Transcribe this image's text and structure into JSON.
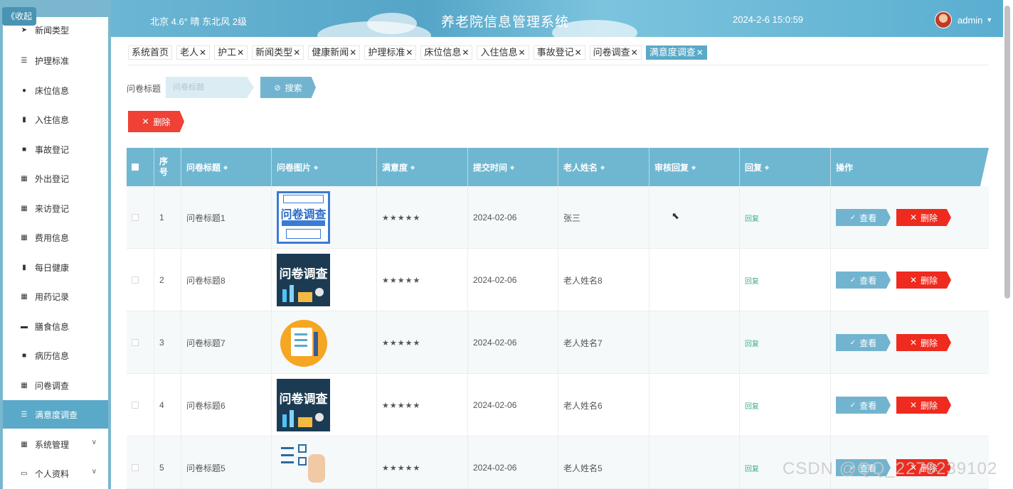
{
  "sidebar": {
    "collapse_label": "《收起",
    "items": [
      {
        "label": "新闻类型",
        "icon": "send-icon"
      },
      {
        "label": "护理标准",
        "icon": "list-icon"
      },
      {
        "label": "床位信息",
        "icon": "user-icon"
      },
      {
        "label": "入住信息",
        "icon": "bar-chart-icon"
      },
      {
        "label": "事故登记",
        "icon": "clipboard-icon"
      },
      {
        "label": "外出登记",
        "icon": "grid-icon"
      },
      {
        "label": "来访登记",
        "icon": "grid-icon"
      },
      {
        "label": "费用信息",
        "icon": "grid-icon"
      },
      {
        "label": "每日健康",
        "icon": "chart-icon"
      },
      {
        "label": "用药记录",
        "icon": "grid-icon"
      },
      {
        "label": "膳食信息",
        "icon": "monitor-icon"
      },
      {
        "label": "病历信息",
        "icon": "clipboard-check-icon"
      },
      {
        "label": "问卷调查",
        "icon": "grid-icon"
      },
      {
        "label": "满意度调查",
        "icon": "list-icon"
      },
      {
        "label": "系统管理",
        "icon": "grid-icon"
      },
      {
        "label": "个人资料",
        "icon": "profile-icon"
      }
    ]
  },
  "header": {
    "weather": "北京  4.6°  晴  东北风  2级",
    "title": "养老院信息管理系统",
    "datetime": "2024-2-6 15:0:59",
    "username": "admin"
  },
  "tabs": [
    {
      "label": "系统首页"
    },
    {
      "label": "老人"
    },
    {
      "label": "护工"
    },
    {
      "label": "新闻类型"
    },
    {
      "label": "健康新闻"
    },
    {
      "label": "护理标准"
    },
    {
      "label": "床位信息"
    },
    {
      "label": "入住信息"
    },
    {
      "label": "事故登记"
    },
    {
      "label": "问卷调查"
    },
    {
      "label": "满意度调查"
    }
  ],
  "search": {
    "label": "问卷标题",
    "placeholder": "问卷标题",
    "button": "搜索"
  },
  "toolbar": {
    "delete_label": "删除"
  },
  "table": {
    "headers": {
      "index": "序号",
      "title": "问卷标题",
      "image": "问卷图片",
      "satisfaction": "满意度",
      "submit_time": "提交时间",
      "elder_name": "老人姓名",
      "review": "审核回复",
      "reply": "回复",
      "actions": "操作"
    },
    "rows": [
      {
        "index": "1",
        "title": "问卷标题1",
        "image_text": "问卷调查",
        "satisfaction": "★★★★★",
        "submit_time": "2024-02-06",
        "elder_name": "张三",
        "review": "",
        "reply": "回复"
      },
      {
        "index": "2",
        "title": "问卷标题8",
        "image_text": "问卷调查",
        "satisfaction": "★★★★★",
        "submit_time": "2024-02-06",
        "elder_name": "老人姓名8",
        "review": "",
        "reply": "回复"
      },
      {
        "index": "3",
        "title": "问卷标题7",
        "image_text": "",
        "satisfaction": "★★★★★",
        "submit_time": "2024-02-06",
        "elder_name": "老人姓名7",
        "review": "",
        "reply": "回复"
      },
      {
        "index": "4",
        "title": "问卷标题6",
        "image_text": "问卷调查",
        "satisfaction": "★★★★★",
        "submit_time": "2024-02-06",
        "elder_name": "老人姓名6",
        "review": "",
        "reply": "回复"
      },
      {
        "index": "5",
        "title": "问卷标题5",
        "image_text": "",
        "satisfaction": "★★★★★",
        "submit_time": "2024-02-06",
        "elder_name": "老人姓名5",
        "review": "",
        "reply": "回复"
      }
    ],
    "view_label": "查看",
    "delete_label": "删除"
  },
  "watermark": "CSDN @QQ_2279239102",
  "colors": {
    "accent": "#5aa9c8",
    "danger": "#ef4136",
    "reply": "#3ab07f"
  }
}
